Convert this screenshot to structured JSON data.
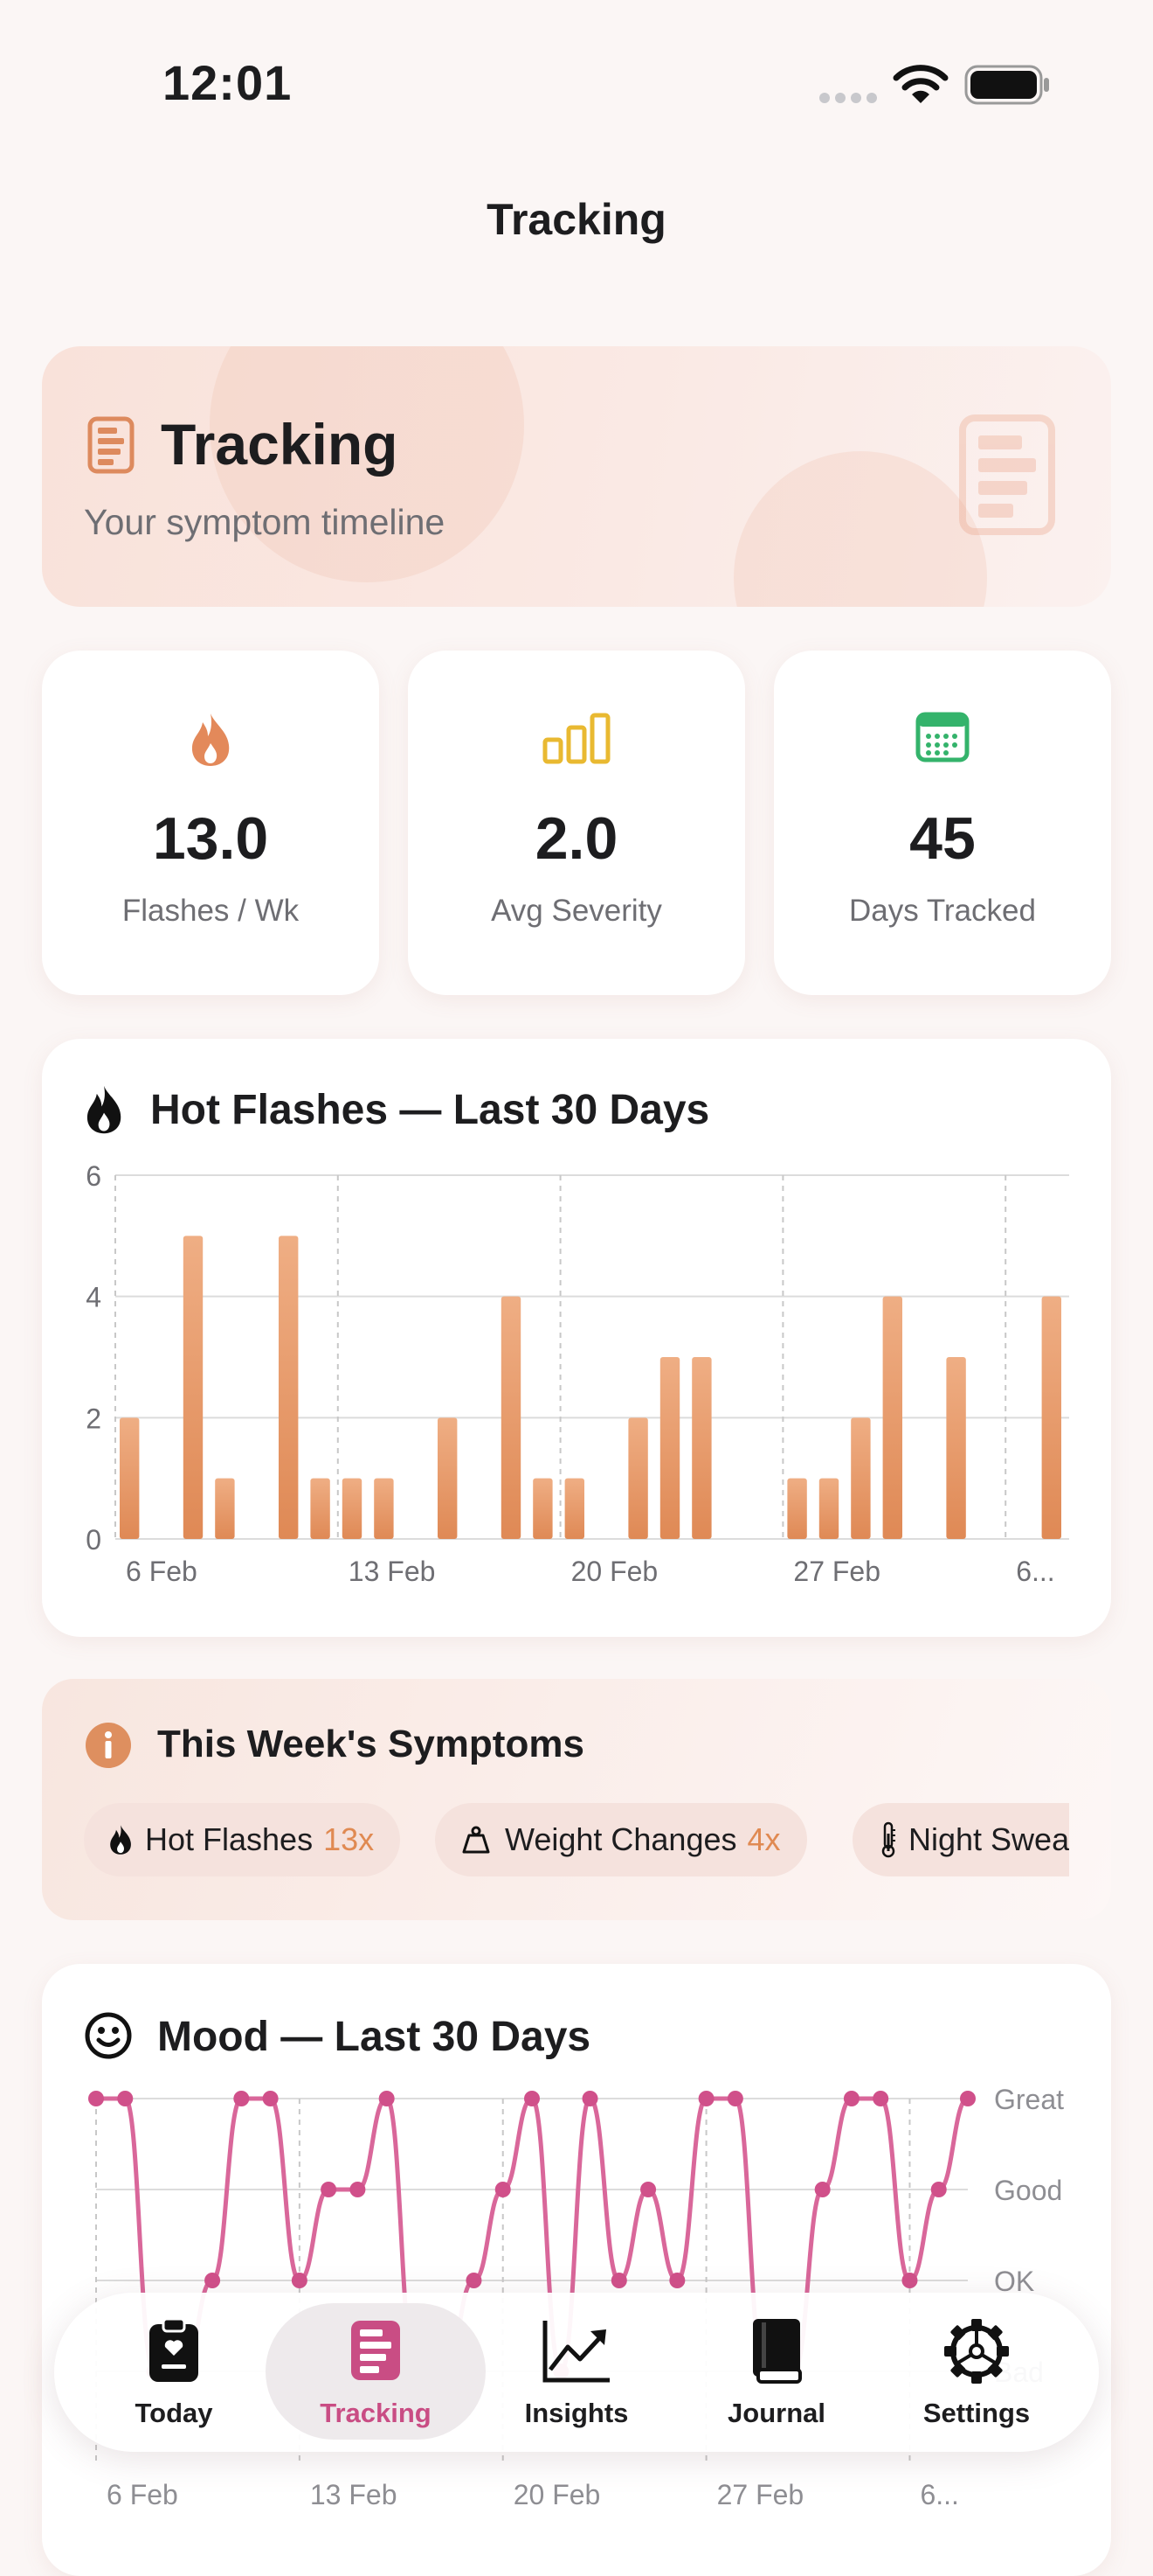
{
  "status_bar": {
    "time": "12:01"
  },
  "nav": {
    "title": "Tracking"
  },
  "header": {
    "title": "Tracking",
    "subtitle": "Your symptom timeline"
  },
  "stats": [
    {
      "value": "13.0",
      "label": "Flashes / Wk",
      "icon": "flame-icon"
    },
    {
      "value": "2.0",
      "label": "Avg Severity",
      "icon": "bars-icon"
    },
    {
      "value": "45",
      "label": "Days Tracked",
      "icon": "calendar-icon"
    }
  ],
  "hot_flashes_card": {
    "title": "Hot Flashes — Last 30 Days"
  },
  "symptoms_card": {
    "title": "This Week's Symptoms",
    "chips": [
      {
        "label": "Hot Flashes",
        "count": "13x",
        "icon": "flame-icon"
      },
      {
        "label": "Weight Changes",
        "count": "4x",
        "icon": "scale-icon"
      },
      {
        "label": "Night Swea",
        "count": "",
        "icon": "thermometer-icon"
      }
    ]
  },
  "mood_card": {
    "title": "Mood — Last 30 Days"
  },
  "tabs": [
    {
      "label": "Today",
      "icon": "clipboard-heart-icon",
      "active": false
    },
    {
      "label": "Tracking",
      "icon": "list-doc-icon",
      "active": true
    },
    {
      "label": "Insights",
      "icon": "trend-chart-icon",
      "active": false
    },
    {
      "label": "Journal",
      "icon": "book-icon",
      "active": false
    },
    {
      "label": "Settings",
      "icon": "gear-icon",
      "active": false
    }
  ],
  "colors": {
    "accent": "#e08a52",
    "mood": "#d9679a",
    "active_tab": "#c94d84",
    "calendar": "#34b36b",
    "bars": "#e9b931"
  },
  "chart_data": [
    {
      "type": "bar",
      "title": "Hot Flashes — Last 30 Days",
      "x_ticks": [
        "6 Feb",
        "13 Feb",
        "20 Feb",
        "27 Feb",
        "6..."
      ],
      "x": [
        "6 Feb",
        "7 Feb",
        "8 Feb",
        "9 Feb",
        "10 Feb",
        "11 Feb",
        "12 Feb",
        "13 Feb",
        "14 Feb",
        "15 Feb",
        "16 Feb",
        "17 Feb",
        "18 Feb",
        "19 Feb",
        "20 Feb",
        "21 Feb",
        "22 Feb",
        "23 Feb",
        "24 Feb",
        "25 Feb",
        "26 Feb",
        "27 Feb",
        "28 Feb",
        "1 Mar",
        "2 Mar",
        "3 Mar",
        "4 Mar",
        "5 Mar",
        "6 Mar",
        "7 Mar"
      ],
      "values": [
        2,
        0,
        5,
        1,
        0,
        5,
        1,
        1,
        1,
        0,
        2,
        0,
        4,
        1,
        1,
        0,
        2,
        3,
        3,
        0,
        0,
        1,
        1,
        2,
        4,
        0,
        3,
        0,
        0,
        4
      ],
      "y_ticks": [
        0,
        2,
        4,
        6
      ],
      "ylim": [
        0,
        6
      ],
      "grid": true
    },
    {
      "type": "line",
      "title": "Mood — Last 30 Days",
      "x_ticks": [
        "6 Feb",
        "13 Feb",
        "20 Feb",
        "27 Feb",
        "6..."
      ],
      "y_ticks": [
        "Great",
        "Good",
        "OK",
        "Bad"
      ],
      "values": [
        4,
        4,
        1,
        1,
        2,
        4,
        4,
        2,
        3,
        3,
        4,
        1,
        1,
        2,
        3,
        4,
        1,
        4,
        2,
        3,
        2,
        4,
        4,
        1,
        1,
        3,
        4,
        4,
        2,
        3,
        4
      ],
      "ylim": [
        0,
        4
      ],
      "grid": true
    }
  ]
}
